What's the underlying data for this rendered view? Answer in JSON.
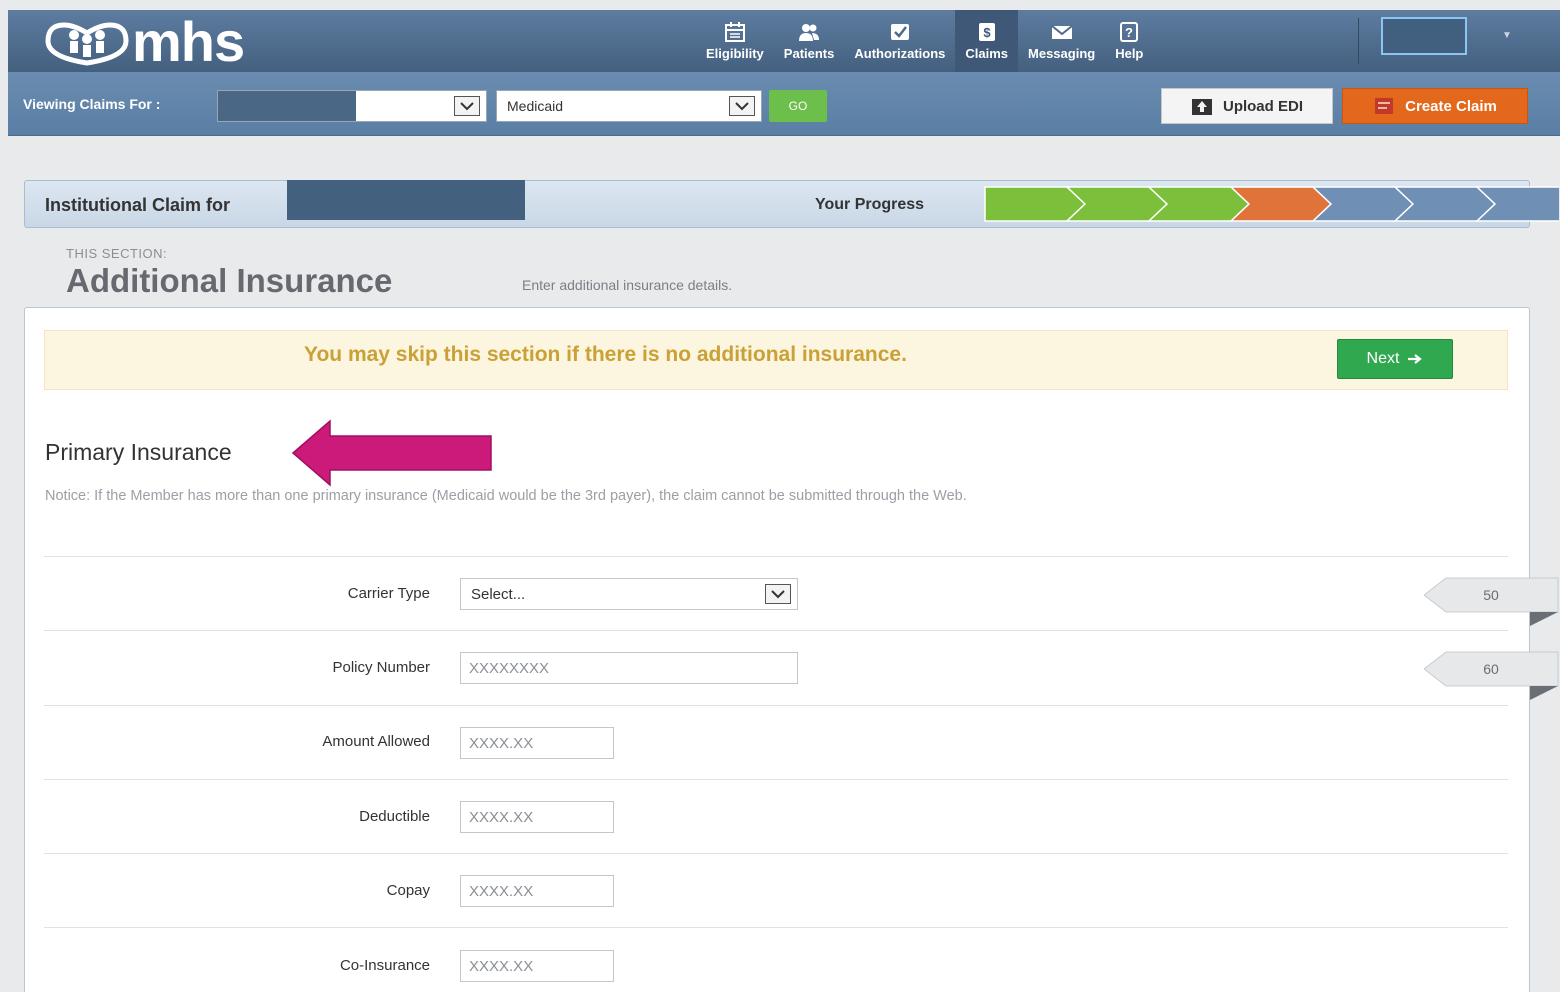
{
  "app": {
    "logo_text": "mhs"
  },
  "nav": [
    {
      "label": "Eligibility",
      "icon": "calendar-icon"
    },
    {
      "label": "Patients",
      "icon": "users-icon"
    },
    {
      "label": "Authorizations",
      "icon": "check-icon"
    },
    {
      "label": "Claims",
      "icon": "dollar-icon"
    },
    {
      "label": "Messaging",
      "icon": "envelope-icon"
    },
    {
      "label": "Help",
      "icon": "question-icon"
    }
  ],
  "subbar": {
    "viewing_label": "Viewing Claims For :",
    "plan_value": "Medicaid",
    "go_label": "GO",
    "upload_label": "Upload EDI",
    "create_label": "Create Claim"
  },
  "claim": {
    "title": "Institutional Claim for",
    "progress_label": "Your Progress",
    "progress_steps": [
      "complete",
      "complete",
      "complete",
      "current",
      "pending",
      "pending",
      "pending"
    ],
    "colors": {
      "complete": "#7bbf3a",
      "current": "#e0733a",
      "pending": "#6f8fb5"
    }
  },
  "section": {
    "caption": "THIS SECTION:",
    "title": "Additional Insurance",
    "description": "Enter additional insurance details."
  },
  "notice": {
    "text": "You may skip this section if there is no additional insurance.",
    "next_label": "Next"
  },
  "primary": {
    "title": "Primary Insurance",
    "notice": "Notice: If the Member has more than one primary insurance (Medicaid would be the 3rd payer), the claim cannot be submitted through the Web.",
    "arrow_color": "#cc1a7a"
  },
  "fields": {
    "carrier_type": {
      "label": "Carrier Type",
      "value": "Select..."
    },
    "policy_number": {
      "label": "Policy Number",
      "placeholder": "XXXXXXXX"
    },
    "amount_allowed": {
      "label": "Amount Allowed",
      "placeholder": "XXXX.XX"
    },
    "deductible": {
      "label": "Deductible",
      "placeholder": "XXXX.XX"
    },
    "copay": {
      "label": "Copay",
      "placeholder": "XXXX.XX"
    },
    "co_insurance": {
      "label": "Co-Insurance",
      "placeholder": "XXXX.XX"
    }
  },
  "counters": [
    "50",
    "60"
  ]
}
